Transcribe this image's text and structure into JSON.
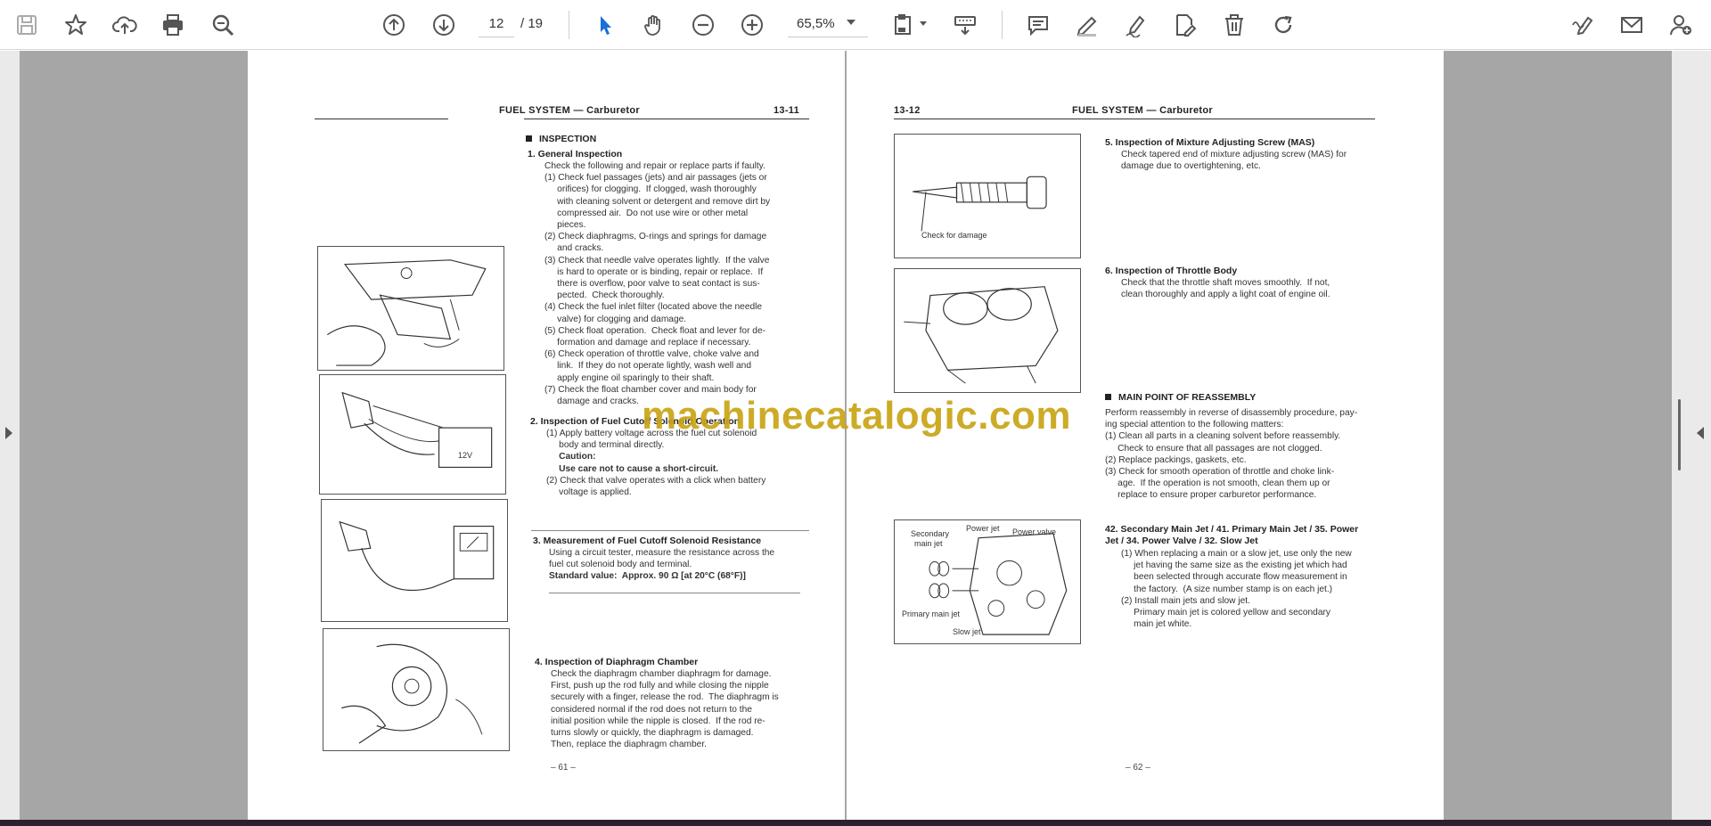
{
  "toolbar": {
    "icons": [
      "save-icon",
      "bookmark-star-icon",
      "upload-cloud-icon",
      "print-icon",
      "zoom-out-glass-icon",
      "scroll-up-icon",
      "scroll-down-icon",
      "select-arrow-icon",
      "hand-icon",
      "zoom-minus-icon",
      "zoom-plus-icon",
      "page-fit-icon",
      "keyboard-icon",
      "comment-icon",
      "pen-icon",
      "signature-icon",
      "edit-doc-icon",
      "trash-icon",
      "rotate-icon",
      "sign-tool-icon",
      "email-icon",
      "add-user-icon"
    ],
    "current_page": "12",
    "total_pages": "/ 19",
    "zoom": "65,5%",
    "accent_color": "#1b6fd6"
  },
  "watermark": "machinecatalogic.com",
  "left_page": {
    "header_title": "FUEL SYSTEM — Carburetor",
    "header_num": "13-11",
    "section": "INSPECTION",
    "items": [
      {
        "title": "1.  General Inspection",
        "lines": [
          "Check the following and repair or replace parts if faulty.",
          "(1) Check fuel passages (jets) and air passages (jets or",
          "     orifices) for clogging.  If clogged, wash thoroughly",
          "     with cleaning solvent or detergent and remove dirt by",
          "     compressed air.  Do not use wire or other metal",
          "     pieces.",
          "(2) Check diaphragms, O-rings and springs for damage",
          "     and cracks.",
          "(3) Check that needle valve operates lightly.  If the valve",
          "     is hard to operate or is binding, repair or replace.  If",
          "     there is overflow, poor valve to seat contact is sus-",
          "     pected.  Check thoroughly.",
          "(4) Check the fuel inlet filter (located above the needle",
          "     valve) for clogging and damage.",
          "(5) Check float operation.  Check float and lever for de-",
          "     formation and damage and replace if necessary.",
          "(6) Check operation of throttle valve, choke valve and",
          "     link.  If they do not operate lightly, wash well and",
          "     apply engine oil sparingly to their shaft.",
          "(7) Check the float chamber cover and main body for",
          "     damage and cracks."
        ]
      },
      {
        "title": "2.  Inspection of Fuel Cutoff Solenoid Operation",
        "lines": [
          "(1) Apply battery voltage across the fuel cut solenoid",
          "     body and terminal directly.",
          "     Caution:",
          "     Use care not to cause a short-circuit.",
          "(2) Check that valve operates with a click when battery",
          "     voltage is applied."
        ]
      },
      {
        "title": "3.  Measurement of Fuel Cutoff Solenoid Resistance",
        "lines": [
          "Using a circuit tester, measure the resistance across the",
          "fuel cut solenoid body and terminal.",
          "Standard value:  Approx. 90 Ω [at 20°C (68°F)]"
        ]
      },
      {
        "title": "4.  Inspection of Diaphragm Chamber",
        "lines": [
          "Check the diaphragm chamber diaphragm for damage.",
          "First, push up the rod fully and while closing the nipple",
          "securely with a finger, release the rod.  The diaphragm is",
          "considered normal if the rod does not return to the",
          "initial position while the nipple is closed.  If the rod re-",
          "turns slowly or quickly, the diaphragm is damaged.",
          "Then, replace the diaphragm chamber."
        ]
      }
    ],
    "fig_12v_label": "12V",
    "page_foot": "– 61 –"
  },
  "right_page": {
    "header_num": "13-12",
    "header_title": "FUEL SYSTEM — Carburetor",
    "fig1_label": "Check for damage",
    "item5_title": "5.  Inspection of Mixture Adjusting Screw (MAS)",
    "item5_lines": [
      "Check tapered end of mixture adjusting screw (MAS) for",
      "damage due to overtightening, etc."
    ],
    "item6_title": "6.  Inspection of Throttle Body",
    "item6_lines": [
      "Check that the throttle shaft moves smoothly.  If not,",
      "clean thoroughly and apply a light coat of engine oil."
    ],
    "section": "MAIN POINT OF REASSEMBLY",
    "reassembly_lines": [
      "Perform reassembly in reverse of disassembly procedure, pay-",
      "ing special attention to the following matters:",
      "(1) Clean all parts in a cleaning solvent before reassembly.",
      "     Check to ensure that all passages are not clogged.",
      "(2) Replace packings, gaskets, etc.",
      "(3) Check for smooth operation of throttle and choke link-",
      "     age.  If the operation is not smooth, clean them up or",
      "     replace to ensure proper carburetor performance."
    ],
    "jet_title_1": "42. Secondary Main Jet / 41.  Primary Main Jet / 35.  Power",
    "jet_title_2": "Jet / 34.  Power Valve / 32.  Slow Jet",
    "jet_lines": [
      "(1) When replacing a main or a slow jet, use only the new",
      "     jet having the same size as the existing jet which had",
      "     been selected through accurate flow measurement in",
      "     the factory.  (A size number stamp is on each jet.)",
      "(2) Install main jets and slow jet.",
      "     Primary main jet is colored yellow and secondary",
      "     main jet white."
    ],
    "fig3_labels": {
      "secondary": "Secondary",
      "main_jet": "main jet",
      "power_jet": "Power jet",
      "power_valve": "Power valve",
      "primary": "Primary main jet",
      "slow": "Slow jet"
    },
    "page_foot": "– 62 –"
  }
}
